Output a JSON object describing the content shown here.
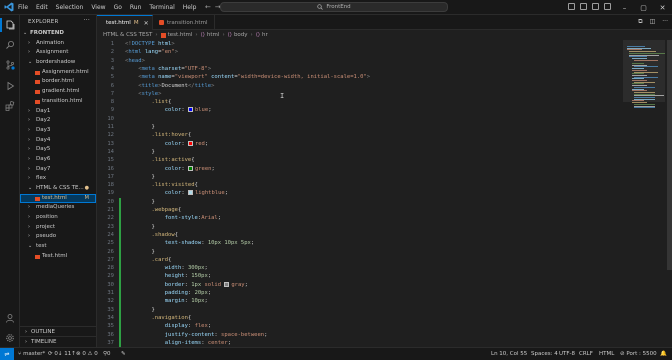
{
  "menu": [
    "File",
    "Edit",
    "Selection",
    "View",
    "Go",
    "Run",
    "Terminal",
    "Help"
  ],
  "command_center": "FrontEnd",
  "explorer": {
    "title": "EXPLORER",
    "root": "FRONTEND",
    "items": [
      {
        "label": "Animation",
        "kind": "folder",
        "depth": 1,
        "open": false
      },
      {
        "label": "Assignment",
        "kind": "folder",
        "depth": 1,
        "open": false
      },
      {
        "label": "bordershadow",
        "kind": "folder",
        "depth": 1,
        "open": true
      },
      {
        "label": "Assignment.html",
        "kind": "file",
        "depth": 2
      },
      {
        "label": "border.html",
        "kind": "file",
        "depth": 2
      },
      {
        "label": "gradient.html",
        "kind": "file",
        "depth": 2
      },
      {
        "label": "transition.html",
        "kind": "file",
        "depth": 2
      },
      {
        "label": "Day1",
        "kind": "folder",
        "depth": 1,
        "open": false
      },
      {
        "label": "Day2",
        "kind": "folder",
        "depth": 1,
        "open": false
      },
      {
        "label": "Day3",
        "kind": "folder",
        "depth": 1,
        "open": false
      },
      {
        "label": "Day4",
        "kind": "folder",
        "depth": 1,
        "open": false
      },
      {
        "label": "Day5",
        "kind": "folder",
        "depth": 1,
        "open": false
      },
      {
        "label": "Day6",
        "kind": "folder",
        "depth": 1,
        "open": false
      },
      {
        "label": "Day7",
        "kind": "folder",
        "depth": 1,
        "open": false
      },
      {
        "label": "flex",
        "kind": "folder",
        "depth": 1,
        "open": false
      },
      {
        "label": "HTML & CSS TE...",
        "kind": "folder",
        "depth": 1,
        "open": true,
        "badge": "●"
      },
      {
        "label": "test.html",
        "kind": "file",
        "depth": 2,
        "badge": "M",
        "selected": true
      },
      {
        "label": "mediaQueries",
        "kind": "folder",
        "depth": 1,
        "open": false
      },
      {
        "label": "position",
        "kind": "folder",
        "depth": 1,
        "open": false
      },
      {
        "label": "project",
        "kind": "folder",
        "depth": 1,
        "open": false
      },
      {
        "label": "pseudo",
        "kind": "folder",
        "depth": 1,
        "open": false
      },
      {
        "label": "test",
        "kind": "folder",
        "depth": 1,
        "open": true
      },
      {
        "label": "Test.html",
        "kind": "file",
        "depth": 2
      }
    ],
    "outline": "OUTLINE",
    "timeline": "TIMELINE"
  },
  "tabs": [
    {
      "label": "test.html",
      "modified": "M",
      "active": true
    },
    {
      "label": "transition.html",
      "active": false
    }
  ],
  "breadcrumb": [
    "HTML & CSS TEST",
    "test.html",
    "html",
    "body",
    "hr"
  ],
  "code_lines": [
    [
      [
        "t-tagb",
        "<!"
      ],
      [
        "t-tag",
        "DOCTYPE"
      ],
      [
        "t-attr",
        " html"
      ],
      [
        "t-tagb",
        ">"
      ]
    ],
    [
      [
        "t-tagb",
        "<"
      ],
      [
        "t-tag",
        "html"
      ],
      [
        "t-attr",
        " lang"
      ],
      [
        "t-punc",
        "="
      ],
      [
        "t-str",
        "\"en\""
      ],
      [
        "t-tagb",
        ">"
      ]
    ],
    [
      [
        "t-tagb",
        "<"
      ],
      [
        "t-tag",
        "head"
      ],
      [
        "t-tagb",
        ">"
      ]
    ],
    [
      [
        "t-text",
        "    "
      ],
      [
        "t-tagb",
        "<"
      ],
      [
        "t-tag",
        "meta"
      ],
      [
        "t-attr",
        " charset"
      ],
      [
        "t-punc",
        "="
      ],
      [
        "t-str",
        "\"UTF-8\""
      ],
      [
        "t-tagb",
        ">"
      ]
    ],
    [
      [
        "t-text",
        "    "
      ],
      [
        "t-tagb",
        "<"
      ],
      [
        "t-tag",
        "meta"
      ],
      [
        "t-attr",
        " name"
      ],
      [
        "t-punc",
        "="
      ],
      [
        "t-str",
        "\"viewport\""
      ],
      [
        "t-attr",
        " content"
      ],
      [
        "t-punc",
        "="
      ],
      [
        "t-str",
        "\"width=device-width, initial-scale=1.0\""
      ],
      [
        "t-tagb",
        ">"
      ]
    ],
    [
      [
        "t-text",
        "    "
      ],
      [
        "t-tagb",
        "<"
      ],
      [
        "t-tag",
        "title"
      ],
      [
        "t-tagb",
        ">"
      ],
      [
        "t-text",
        "Document"
      ],
      [
        "t-tagb",
        "</"
      ],
      [
        "t-tag",
        "title"
      ],
      [
        "t-tagb",
        ">"
      ]
    ],
    [
      [
        "t-text",
        "    "
      ],
      [
        "t-tagb",
        "<"
      ],
      [
        "t-tag",
        "style"
      ],
      [
        "t-tagb",
        ">"
      ]
    ],
    [
      [
        "t-text",
        "        "
      ],
      [
        "t-sel",
        ".list"
      ],
      [
        "t-punc",
        "{"
      ]
    ],
    [
      [
        "t-text",
        "            "
      ],
      [
        "t-prop",
        "color"
      ],
      [
        "t-punc",
        ": "
      ],
      [
        "swatch",
        "#0000ff"
      ],
      [
        "t-val",
        "blue"
      ],
      [
        "t-punc",
        ";"
      ]
    ],
    [],
    [
      [
        "t-text",
        "        "
      ],
      [
        "t-punc",
        "}"
      ]
    ],
    [
      [
        "t-text",
        "        "
      ],
      [
        "t-sel",
        ".list:hover"
      ],
      [
        "t-punc",
        "{"
      ]
    ],
    [
      [
        "t-text",
        "            "
      ],
      [
        "t-prop",
        "color"
      ],
      [
        "t-punc",
        ": "
      ],
      [
        "swatch",
        "#ff0000"
      ],
      [
        "t-val",
        "red"
      ],
      [
        "t-punc",
        ";"
      ]
    ],
    [
      [
        "t-text",
        "        "
      ],
      [
        "t-punc",
        "}"
      ]
    ],
    [
      [
        "t-text",
        "        "
      ],
      [
        "t-sel",
        ".list:active"
      ],
      [
        "t-punc",
        "{"
      ]
    ],
    [
      [
        "t-text",
        "            "
      ],
      [
        "t-prop",
        "color"
      ],
      [
        "t-punc",
        ": "
      ],
      [
        "swatch",
        "#008000"
      ],
      [
        "t-val",
        "green"
      ],
      [
        "t-punc",
        ";"
      ]
    ],
    [
      [
        "t-text",
        "        "
      ],
      [
        "t-punc",
        "}"
      ]
    ],
    [
      [
        "t-text",
        "        "
      ],
      [
        "t-sel",
        ".list:visited"
      ],
      [
        "t-punc",
        "{"
      ]
    ],
    [
      [
        "t-text",
        "            "
      ],
      [
        "t-prop",
        "color"
      ],
      [
        "t-punc",
        ": "
      ],
      [
        "swatch",
        "#add8e6"
      ],
      [
        "t-val",
        "lightblue"
      ],
      [
        "t-punc",
        ";"
      ]
    ],
    [
      [
        "t-text",
        "        "
      ],
      [
        "t-punc",
        "}"
      ]
    ],
    [
      [
        "t-text",
        "        "
      ],
      [
        "t-sel",
        ".webpage"
      ],
      [
        "t-punc",
        "{"
      ]
    ],
    [
      [
        "t-text",
        "            "
      ],
      [
        "t-prop",
        "font-style"
      ],
      [
        "t-punc",
        ":"
      ],
      [
        "t-val",
        "Arial"
      ],
      [
        "t-punc",
        ";"
      ]
    ],
    [
      [
        "t-text",
        "        "
      ],
      [
        "t-punc",
        "}"
      ]
    ],
    [
      [
        "t-text",
        "        "
      ],
      [
        "t-sel",
        ".shadow"
      ],
      [
        "t-punc",
        "{"
      ]
    ],
    [
      [
        "t-text",
        "            "
      ],
      [
        "t-prop",
        "text-shadow"
      ],
      [
        "t-punc",
        ": "
      ],
      [
        "t-num",
        "10px 10px 5px"
      ],
      [
        "t-punc",
        ";"
      ]
    ],
    [
      [
        "t-text",
        "        "
      ],
      [
        "t-punc",
        "}"
      ]
    ],
    [
      [
        "t-text",
        "        "
      ],
      [
        "t-sel",
        ".card"
      ],
      [
        "t-punc",
        "{"
      ]
    ],
    [
      [
        "t-text",
        "            "
      ],
      [
        "t-prop",
        "width"
      ],
      [
        "t-punc",
        ": "
      ],
      [
        "t-num",
        "300px"
      ],
      [
        "t-punc",
        ";"
      ]
    ],
    [
      [
        "t-text",
        "            "
      ],
      [
        "t-prop",
        "height"
      ],
      [
        "t-punc",
        ": "
      ],
      [
        "t-num",
        "150px"
      ],
      [
        "t-punc",
        ";"
      ]
    ],
    [
      [
        "t-text",
        "            "
      ],
      [
        "t-prop",
        "border"
      ],
      [
        "t-punc",
        ": "
      ],
      [
        "t-num",
        "1px"
      ],
      [
        "t-val",
        " solid "
      ],
      [
        "swatch",
        "#808080"
      ],
      [
        "t-val",
        "gray"
      ],
      [
        "t-punc",
        ";"
      ]
    ],
    [
      [
        "t-text",
        "            "
      ],
      [
        "t-prop",
        "padding"
      ],
      [
        "t-punc",
        ": "
      ],
      [
        "t-num",
        "20px"
      ],
      [
        "t-punc",
        ";"
      ]
    ],
    [
      [
        "t-text",
        "            "
      ],
      [
        "t-prop",
        "margin"
      ],
      [
        "t-punc",
        ": "
      ],
      [
        "t-num",
        "10px"
      ],
      [
        "t-punc",
        ";"
      ]
    ],
    [
      [
        "t-text",
        "        "
      ],
      [
        "t-punc",
        "}"
      ]
    ],
    [
      [
        "t-text",
        "        "
      ],
      [
        "t-sel",
        ".navigation"
      ],
      [
        "t-punc",
        "{"
      ]
    ],
    [
      [
        "t-text",
        "            "
      ],
      [
        "t-prop",
        "display"
      ],
      [
        "t-punc",
        ": "
      ],
      [
        "t-val",
        "flex"
      ],
      [
        "t-punc",
        ";"
      ]
    ],
    [
      [
        "t-text",
        "            "
      ],
      [
        "t-prop",
        "justify-content"
      ],
      [
        "t-punc",
        ": "
      ],
      [
        "t-val",
        "space-between"
      ],
      [
        "t-punc",
        ";"
      ]
    ],
    [
      [
        "t-text",
        "            "
      ],
      [
        "t-prop",
        "align-items"
      ],
      [
        "t-punc",
        ": "
      ],
      [
        "t-val",
        "center"
      ],
      [
        "t-punc",
        ";"
      ]
    ]
  ],
  "status": {
    "branch": "master*",
    "sync": "0↓ 11↑",
    "problems": "⊗ 0 ⚠ 0",
    "ports": "⚲0",
    "cursor": "Ln 10, Col 55",
    "spaces": "Spaces: 4",
    "encoding": "UTF-8",
    "eol": "CRLF",
    "language": "HTML",
    "port": "⊘ Port : 5500"
  },
  "colors": {
    "accent": "#0078d4",
    "modified": "#e2c08d",
    "gutter_modified": "#2ea043"
  }
}
